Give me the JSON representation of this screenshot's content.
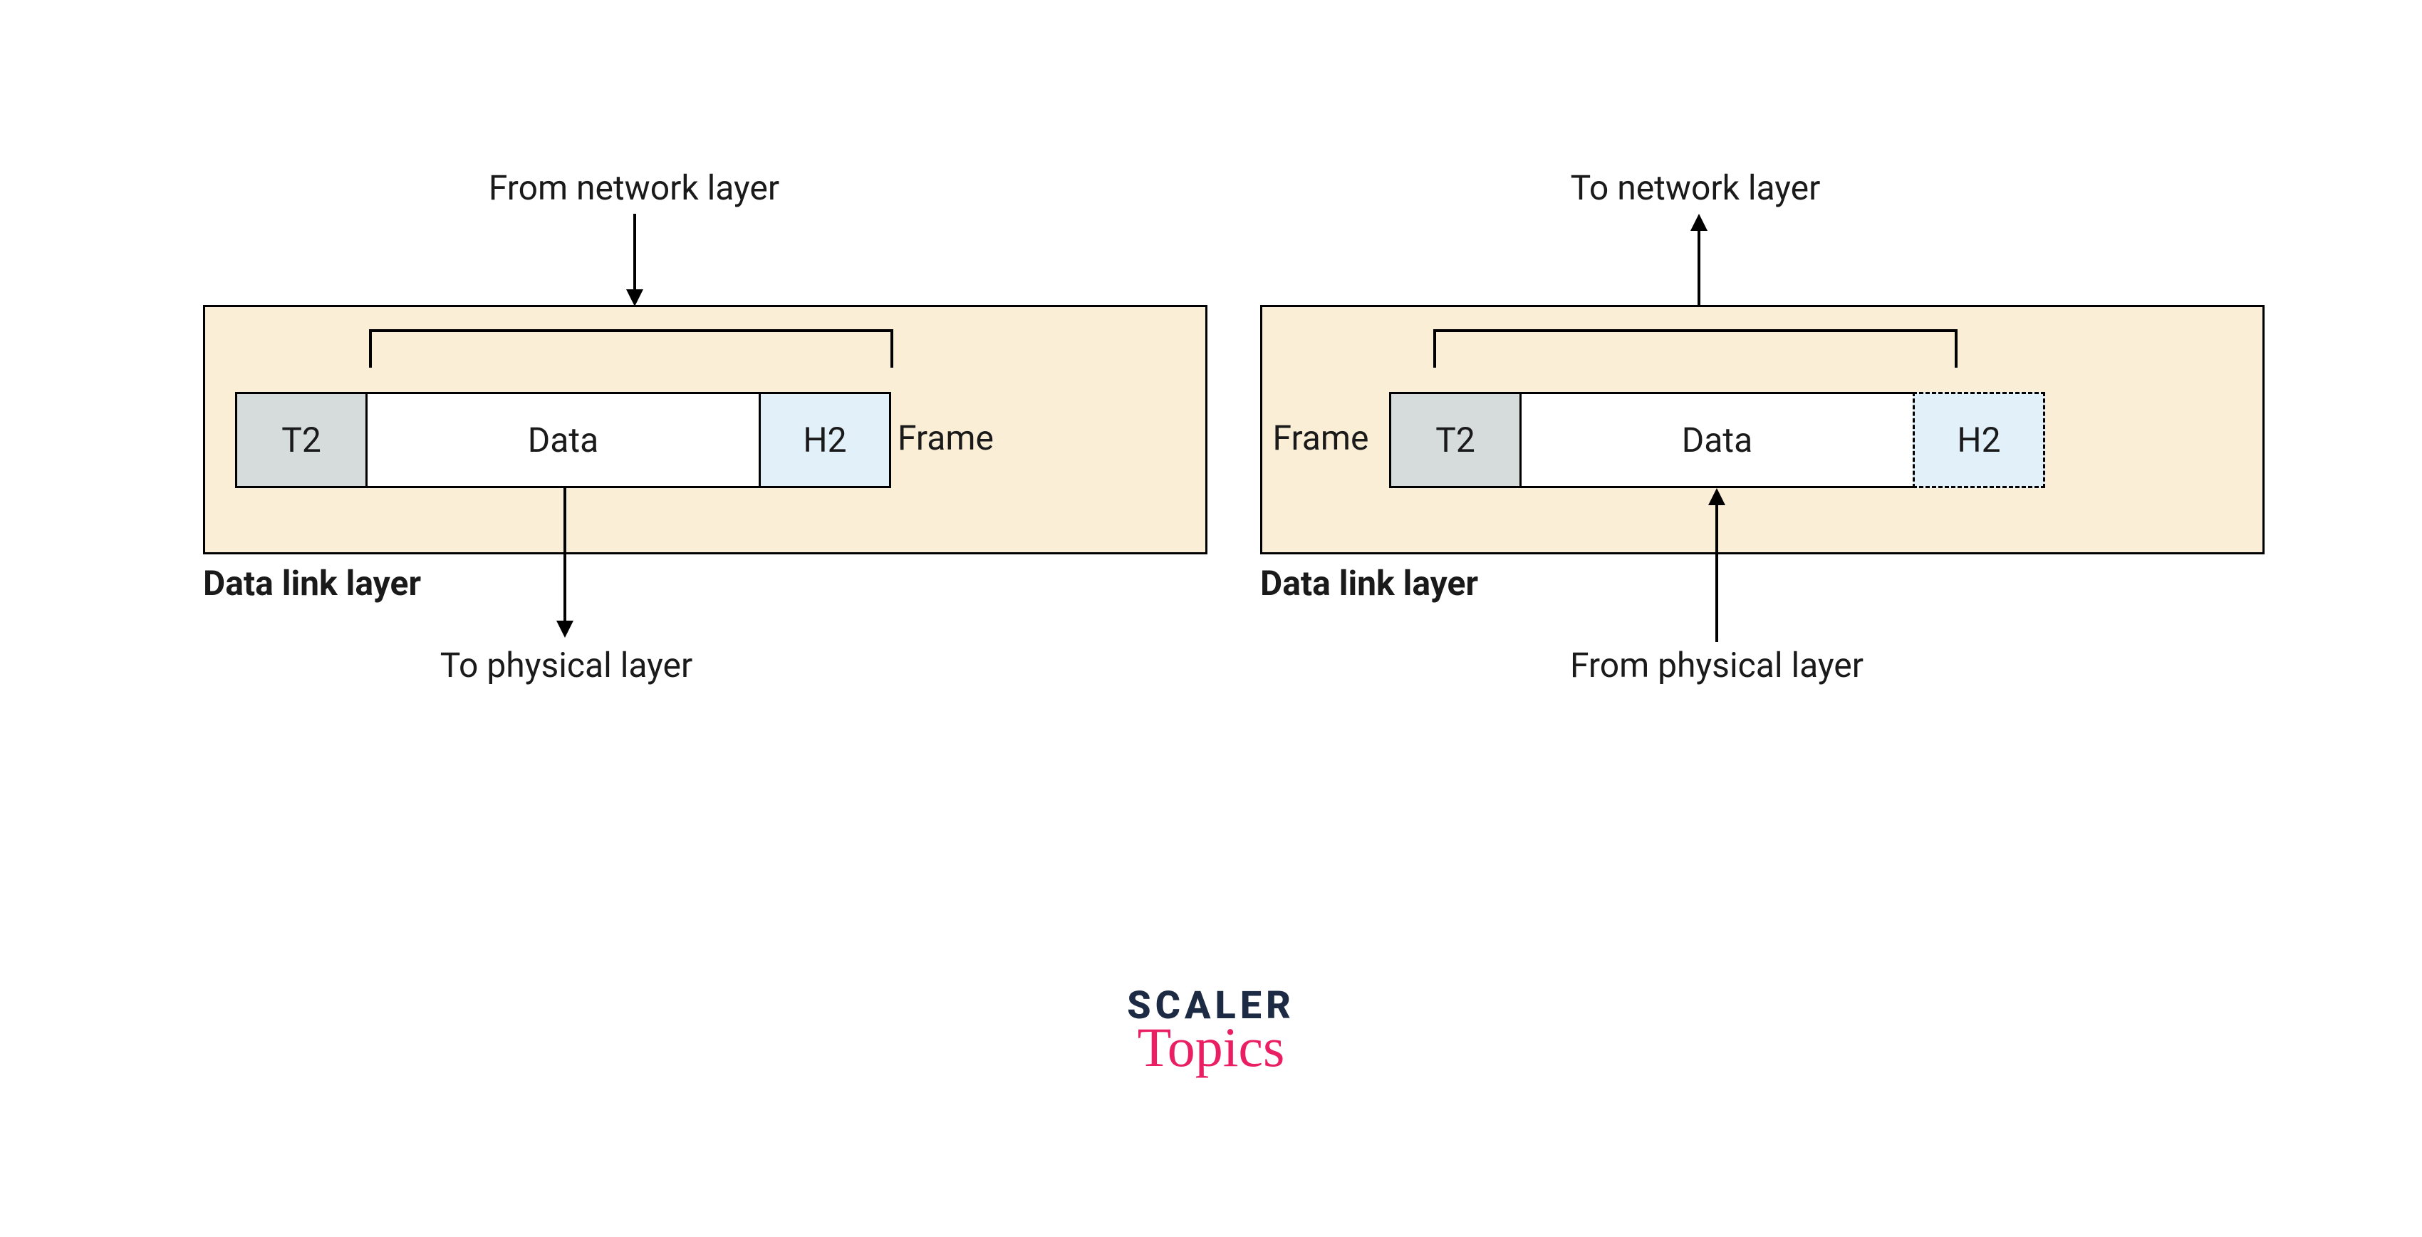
{
  "diagrams": {
    "left": {
      "top_label": "From network layer",
      "layer_label": "Data link layer",
      "bottom_label": "To physical layer",
      "frame_label": "Frame",
      "cells": {
        "t2": "T2",
        "data": "Data",
        "h2": "H2"
      }
    },
    "right": {
      "top_label": "To network layer",
      "layer_label": "Data link layer",
      "bottom_label": "From physical layer",
      "frame_label": "Frame",
      "cells": {
        "t2": "T2",
        "data": "Data",
        "h2": "H2"
      }
    }
  },
  "logo": {
    "line1": "SCALER",
    "line2": "Topics"
  }
}
